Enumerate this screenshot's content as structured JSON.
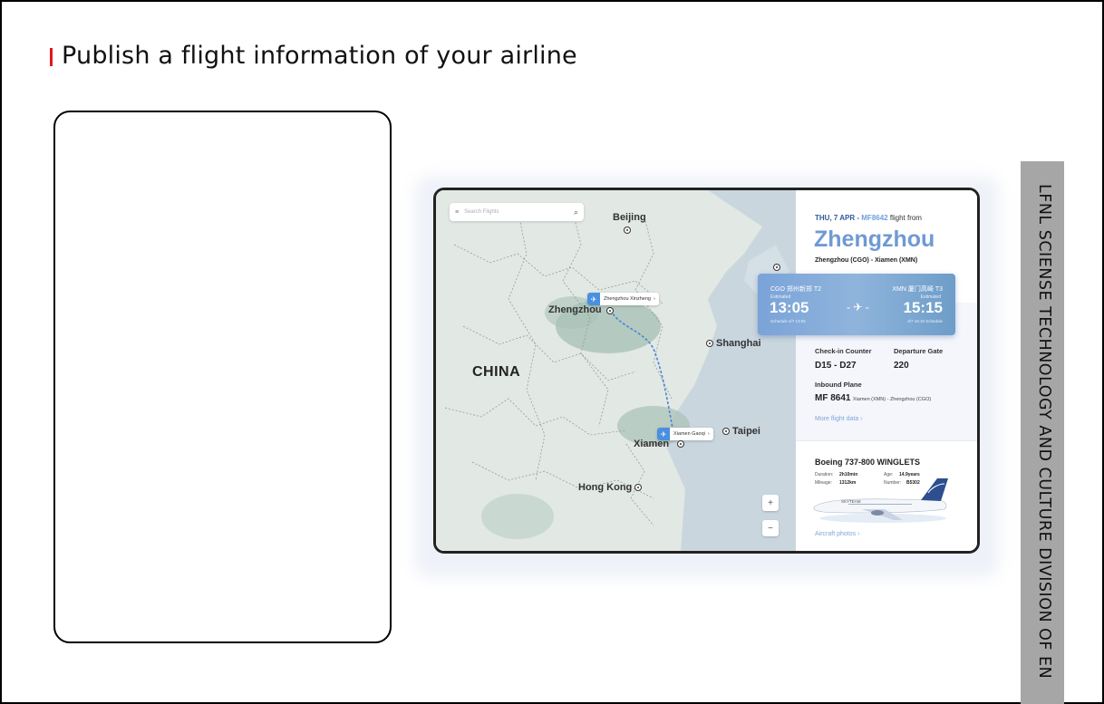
{
  "slide": {
    "title": "Publish a flight information of your airline",
    "side_label": "LFNL SCIENSE TECHNOLOGY AND CULTURE DIVISION OF EN",
    "accent_color": "#e8141b"
  },
  "app": {
    "search_placeholder": "Search Flights",
    "map": {
      "country": "CHINA",
      "cities": {
        "beijing": "Beijing",
        "zhengzhou": "Zhengzhou",
        "shanghai": "Shanghai",
        "taipei": "Taipei",
        "xiamen": "Xiamen",
        "hongkong": "Hong Kong"
      },
      "tags": {
        "origin": "Zhengzhou Xinzheng",
        "destination": "Xiamen Gaoqi"
      },
      "zoom_in": "+",
      "zoom_out": "−"
    },
    "flight": {
      "date": "THU, 7 APR - ",
      "number": "MF8642",
      "from_text": " flight from",
      "city": "Zhengzhou",
      "route": "Zhengzhou (CGO) - Xiamen (XMN)",
      "dep_airport": "CGO 郑州新郑 T2",
      "arr_airport": "XMN 厦门高崎 T3",
      "dep_estimated": "Estimated",
      "arr_estimated": "Estimated",
      "dep_time": "13:05",
      "arr_time": "15:15",
      "dep_schedule": "Schedule 4/7 13:05",
      "arr_schedule": "4/7 15:15 Schedule",
      "checkin_label": "Check-in Counter",
      "checkin_value": "D15 - D27",
      "gate_label": "Departure Gate",
      "gate_value": "220",
      "inbound_label": "Inbound Plane",
      "inbound_value": "MF 8641",
      "inbound_route": "Xiamen (XMN) - Zhengzhou (CGO)",
      "more_link": "More flight data  ›"
    },
    "aircraft": {
      "name": "Boeing 737-800 WINGLETS",
      "duration_label": "Duration:",
      "duration_value": "2h10min",
      "age_label": "Age:",
      "age_value": "14.9years",
      "mileage_label": "Mileage:",
      "mileage_value": "1312km",
      "number_label": "Number:",
      "number_value": "B5302",
      "livery_text": "SKYTEAM",
      "photos_link": "Aircraft photos  ›"
    }
  }
}
